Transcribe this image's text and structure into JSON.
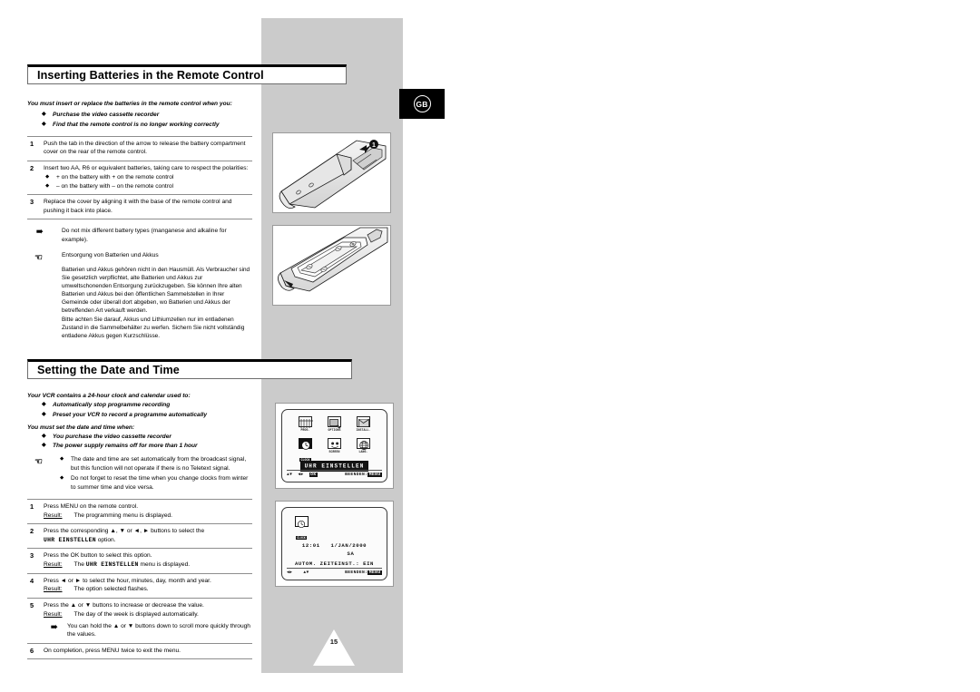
{
  "locale_badge": {
    "label": "GB"
  },
  "page_number": "15",
  "section1": {
    "heading": "Inserting Batteries in the Remote Control",
    "intro": "You must insert or replace the batteries in the remote control when you:",
    "intro_bullets": [
      "Purchase the video cassette recorder",
      "Find that the remote control is no longer working correctly"
    ],
    "steps": [
      {
        "num": "1",
        "text": "Push the tab in the direction of the arrow to release the battery compartment cover on the rear of the remote control."
      },
      {
        "num": "2",
        "text": "Insert two AA, R6 or equivalent batteries, taking care to respect the polarities:",
        "subs": [
          "+ on the battery with + on the remote control",
          "– on the battery with – on the remote control"
        ]
      },
      {
        "num": "3",
        "text": "Replace the cover by aligning it with the base of the remote control and pushing it back into place."
      }
    ],
    "note_mix": "Do not mix different battery types (manganese and alkaline for example).",
    "note_disposal_title": "Entsorgung von Batterien und Akkus",
    "note_disposal_body": "Batterien und Akkus gehören nicht in den Hausmüll. Als Verbraucher sind Sie gesetzlich verpflichtet, alte Batterien und Akkus zur umweltschonenden Entsorgung zurückzugeben. Sie können Ihre alten Batterien und Akkus bei den öffentlichen Sammelstellen in Ihrer Gemeinde oder überall dort abgeben, wo Batterien und Akkus der betreffenden Art verkauft werden.\nBitte achten Sie darauf, Akkus und Lithiumzellen nur im entladenen Zustand in die Sammelbehälter zu werfen. Sichern Sie nicht vollständig entladene Akkus gegen Kurzschlüsse."
  },
  "section2": {
    "heading": "Setting the Date and Time",
    "intro1": "Your VCR contains a 24-hour clock and calendar used to:",
    "intro1_bullets": [
      "Automatically stop programme recording",
      "Preset your VCR to record a programme automatically"
    ],
    "intro2": "You must set the date and time when:",
    "intro2_bullets": [
      "You purchase the video cassette recorder",
      "The power supply remains off for more than 1 hour"
    ],
    "hand_notes": [
      "The date and time are set automatically from the broadcast signal, but this function will not operate if there is no Teletext signal.",
      "Do not forget to reset the time when you change clocks from winter to summer time and vice versa."
    ],
    "steps": [
      {
        "num": "1",
        "text": "Press MENU on the remote control.",
        "result_label": "Result:",
        "result": "The programming menu is displayed."
      },
      {
        "num": "2",
        "text_pre": "Press the corresponding ",
        "text_keys": "▲, ▼ or ◄, ►",
        "text_post": " buttons to select the ",
        "mono": "UHR EINSTELLEN",
        "text_end": " option."
      },
      {
        "num": "3",
        "text": "Press the OK button to select this option.",
        "result_label": "Result:",
        "result_pre": "The ",
        "result_mono": "UHR EINSTELLEN",
        "result_post": " menu is displayed."
      },
      {
        "num": "4",
        "text": "Press ◄ or ► to select the hour, minutes, day, month and year.",
        "result_label": "Result:",
        "result": "The option selected flashes."
      },
      {
        "num": "5",
        "text": "Press the ▲ or ▼ buttons to increase or decrease the value.",
        "result_label": "Result:",
        "result": "The day of the week is displayed automatically.",
        "note": "You can hold the ▲ or ▼ buttons down to scroll more quickly through the values."
      },
      {
        "num": "6",
        "text": "On completion, press MENU twice to exit the menu."
      }
    ]
  },
  "photos": [
    {
      "caption": "remote-control-battery-cover-open"
    },
    {
      "caption": "remote-control-batteries-inserted"
    }
  ],
  "osd1": {
    "icons": [
      {
        "label": "PROG.",
        "selected": false
      },
      {
        "label": "OPTIONS",
        "selected": false
      },
      {
        "label": "INSTALL.",
        "selected": false
      },
      {
        "label": "CLOCK",
        "selected": true
      },
      {
        "label": "SCREEN",
        "selected": false
      },
      {
        "label": "LANG.",
        "selected": false
      }
    ],
    "title": "UHR EINSTELLEN",
    "bottom": {
      "keys1": "▲▼",
      "keys2": "◄►",
      "ok": "OK",
      "exit_label": "BEENDEN:",
      "exit_key": "MENU"
    }
  },
  "osd2": {
    "icon_label": "CLOCK",
    "time": "12:01",
    "date": "1/JAN/2000",
    "weekday": "SA",
    "auto_line": "AUTOM. ZEITEINST.: EIN",
    "bottom": {
      "keys1": "◄►",
      "keys2": "▲▼",
      "exit_label": "BEENDEN:",
      "exit_key": "MENU"
    }
  }
}
